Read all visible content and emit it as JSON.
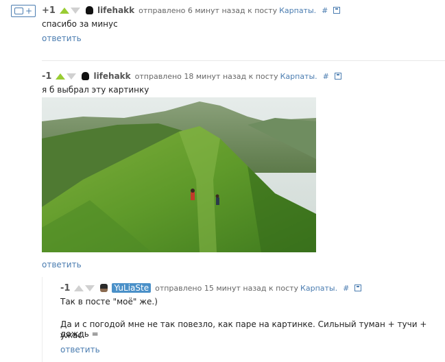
{
  "toolbar": {
    "plus_label": "+"
  },
  "comments": [
    {
      "rating": "+1",
      "user": "lifehakk",
      "meta": "отправлено 6 минут назад к посту",
      "post": "Карпаты.",
      "hash": "#",
      "body": "спасибо за минус",
      "reply": "ответить"
    },
    {
      "rating": "-1",
      "user": "lifehakk",
      "meta": "отправлено 18 минут назад к посту",
      "post": "Карпаты.",
      "hash": "#",
      "body": "я б выбрал эту картинку",
      "reply": "ответить"
    },
    {
      "rating": "-1",
      "user": "YuLiaSte",
      "meta": "отправлено 15 минут назад к посту",
      "post": "Карпаты.",
      "hash": "#",
      "body1": "Так в посте \"моё\" же.)",
      "body2": "Да и с погодой мне не так повезло, как паре на картинке. Сильный туман + тучи + дождь =",
      "body3": "ужас.",
      "reply": "ответить"
    }
  ],
  "colors": {
    "link": "#4a7cb0",
    "vote_up": "#99cc33",
    "vote_inactive": "#d0d0d0"
  },
  "icons": [
    "comment-bubble-icon",
    "vote-up-icon",
    "vote-down-icon",
    "avatar-icon",
    "save-icon"
  ]
}
